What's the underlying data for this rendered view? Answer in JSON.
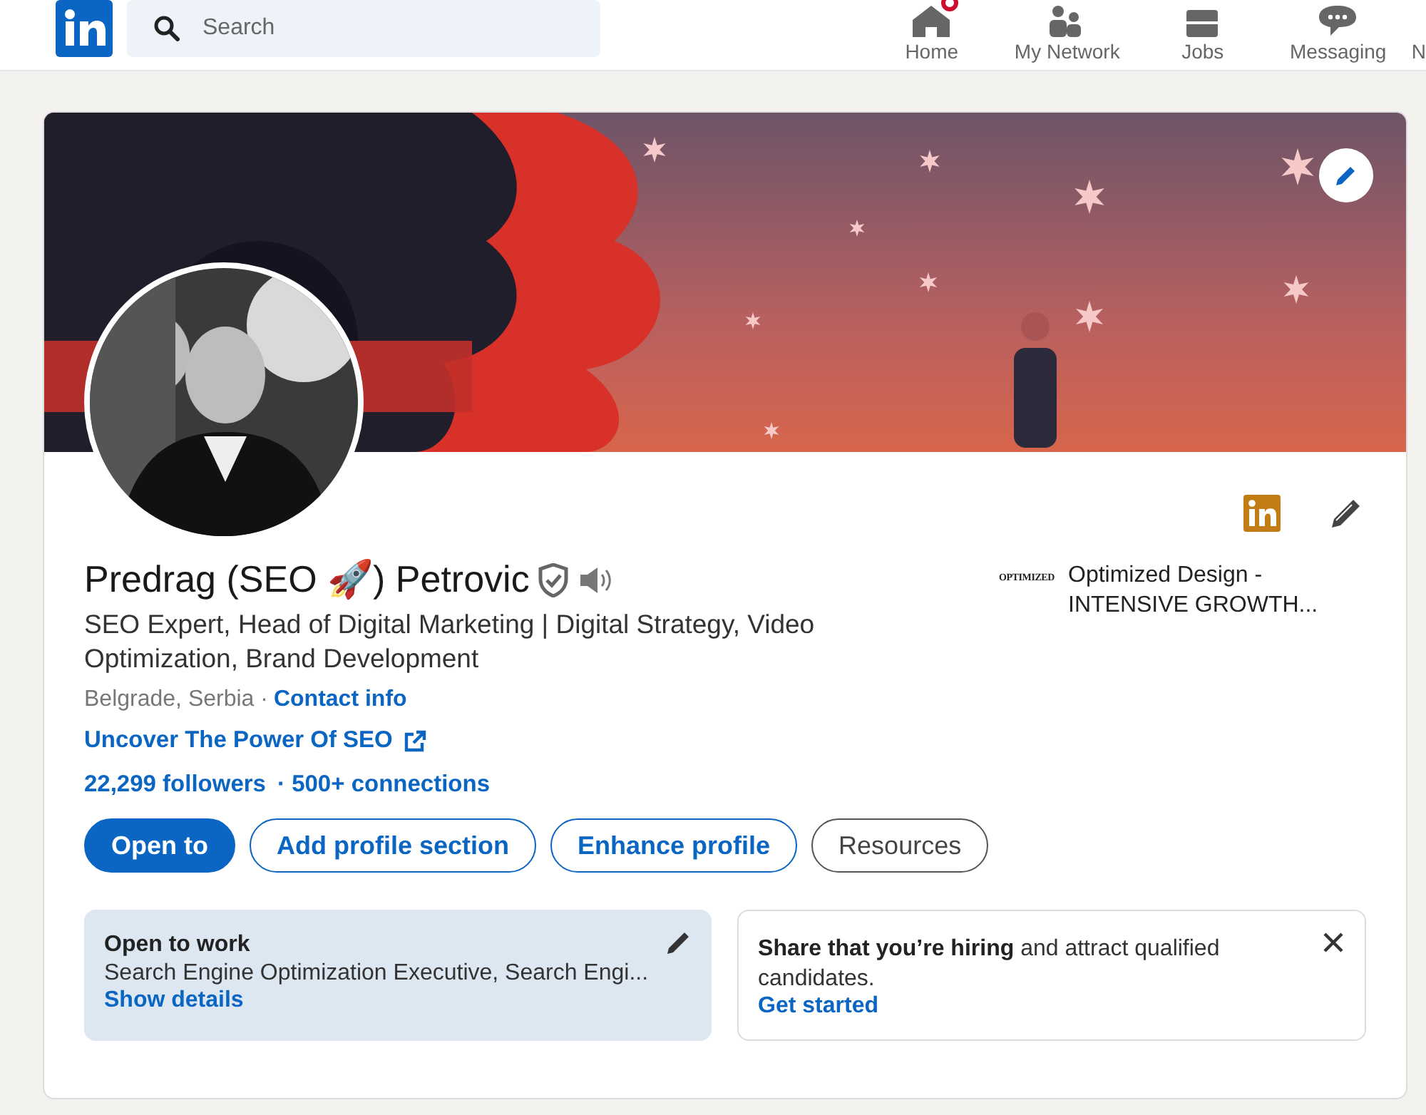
{
  "nav": {
    "search": {
      "placeholder": "Search"
    },
    "items": [
      {
        "label": "Home",
        "kind": "home",
        "notification": true
      },
      {
        "label": "My Network",
        "kind": "people",
        "notification": false
      },
      {
        "label": "Jobs",
        "kind": "briefcase",
        "notification": false
      },
      {
        "label": "Messaging",
        "kind": "chat",
        "notification": false
      },
      {
        "label": "N",
        "kind": "partial",
        "notification": false
      }
    ]
  },
  "profile": {
    "name": "Predrag (SEO 🚀) Petrovic",
    "headline": "SEO Expert, Head of Digital Marketing | Digital Strategy, Video Optimization, Brand Development",
    "location": "Belgrade, Serbia ·",
    "contact_link": "Contact info",
    "website_link": "Uncover The Power Of SEO",
    "followers": "22,299 followers",
    "connections": "· 500+ connections",
    "company": {
      "logo_text": "OPTIMIZED",
      "name": "Optimized Design - INTENSIVE GROWTH..."
    },
    "actions": [
      {
        "label": "Open to",
        "kind": "primary"
      },
      {
        "label": "Add profile section",
        "kind": "outline"
      },
      {
        "label": "Enhance profile",
        "kind": "outline"
      },
      {
        "label": "Resources",
        "kind": "neutral"
      }
    ]
  },
  "cards": [
    {
      "kind": "open_to_work",
      "title": "Open to work",
      "text": "Search Engine Optimization Executive, Search Engi...",
      "link": "Show details"
    },
    {
      "kind": "hiring",
      "text": "**Share that you’re hiring** and attract qualified candidates.",
      "link": "Get started"
    }
  ]
}
